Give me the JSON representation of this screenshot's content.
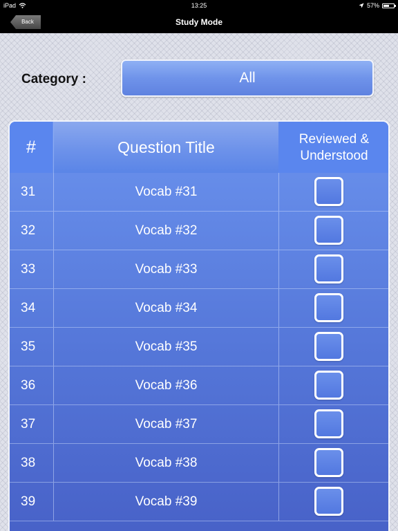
{
  "status_bar": {
    "device": "iPad",
    "time": "13:25",
    "battery": "57%",
    "battery_level": 0.57,
    "icons": [
      "wifi-icon",
      "location-icon",
      "battery-icon"
    ]
  },
  "nav": {
    "back_label": "Back",
    "title": "Study Mode"
  },
  "category": {
    "label": "Category :",
    "selected": "All"
  },
  "table": {
    "headers": {
      "number": "#",
      "title": "Question Title",
      "reviewed": "Reviewed & Understood"
    },
    "rows": [
      {
        "num": "31",
        "title": "Vocab #31",
        "checked": false
      },
      {
        "num": "32",
        "title": "Vocab #32",
        "checked": false
      },
      {
        "num": "33",
        "title": "Vocab #33",
        "checked": false
      },
      {
        "num": "34",
        "title": "Vocab #34",
        "checked": false
      },
      {
        "num": "35",
        "title": "Vocab #35",
        "checked": false
      },
      {
        "num": "36",
        "title": "Vocab #36",
        "checked": false
      },
      {
        "num": "37",
        "title": "Vocab #37",
        "checked": false
      },
      {
        "num": "38",
        "title": "Vocab #38",
        "checked": false
      },
      {
        "num": "39",
        "title": "Vocab #39",
        "checked": false
      }
    ]
  },
  "colors": {
    "accent": "#5a86ee",
    "nav_background": "#000000",
    "text_on_accent": "#ffffff"
  }
}
